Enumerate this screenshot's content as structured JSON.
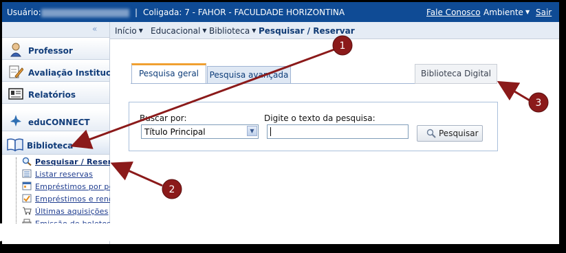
{
  "topbar": {
    "user_label": "Usuário:",
    "separator": "|",
    "coligada": "Coligada: 7 - FAHOR - FACULDADE HORIZONTINA",
    "contact": "Fale Conosco",
    "environment": "Ambiente",
    "logout": "Sair"
  },
  "sidebar": {
    "collapse_glyph": "«",
    "modules": [
      {
        "label": "Professor",
        "icon": "professor-icon"
      },
      {
        "label": "Avaliação Institucio",
        "icon": "pencil-document-icon"
      },
      {
        "label": "Relatórios",
        "icon": "report-icon"
      },
      {
        "label": "eduCONNECT",
        "icon": "bird-icon"
      },
      {
        "label": "Biblioteca",
        "icon": "book-icon"
      }
    ],
    "submenu": [
      {
        "label": "Pesquisar / Reser",
        "icon": "magnifier-icon"
      },
      {
        "label": "Listar reservas",
        "icon": "list-icon"
      },
      {
        "label": "Empréstimos por pe",
        "icon": "loan-calendar-icon"
      },
      {
        "label": "Empréstimos e reno",
        "icon": "checklist-icon"
      },
      {
        "label": "Últimas aquisições",
        "icon": "cart-icon"
      },
      {
        "label": "Emissão de boletos",
        "icon": "printer-icon"
      }
    ]
  },
  "breadcrumb": {
    "items": [
      "Início",
      "Educacional",
      "Biblioteca"
    ],
    "current": "Pesquisar / Reservar"
  },
  "tabs": {
    "general": "Pesquisa geral",
    "advanced": "Pesquisa avançada",
    "digital": "Biblioteca Digital"
  },
  "form": {
    "search_by_label": "Buscar por:",
    "search_by_value": "Título Principal",
    "text_label": "Digite o texto da pesquisa:",
    "text_value": "",
    "search_button": "Pesquisar"
  },
  "callouts": [
    "1",
    "2",
    "3"
  ],
  "colors": {
    "topbar": "#0f4b95",
    "callout": "#8b1a1a",
    "tab_accent": "#f0a030"
  }
}
